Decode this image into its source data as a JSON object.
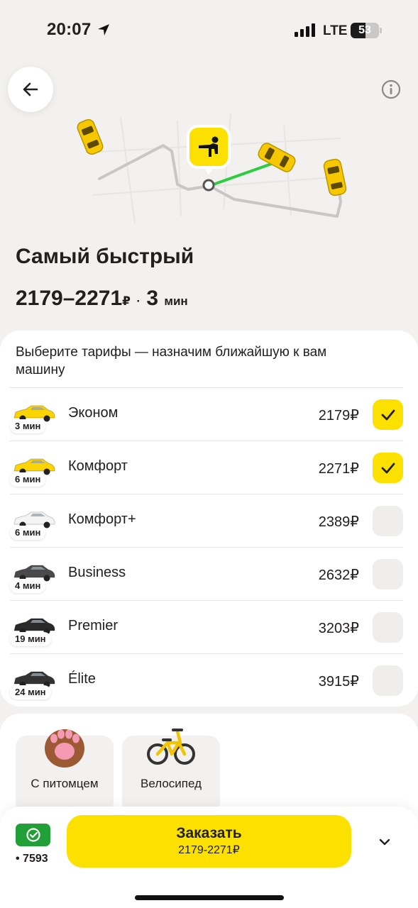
{
  "status_bar": {
    "time": "20:07",
    "network": "LTE",
    "battery_level": "53",
    "battery_fraction": 0.53
  },
  "colors": {
    "accent": "#fce000",
    "check_on": "#fce000",
    "check_off": "#efeeec",
    "route_active": "#2ecc40",
    "payment": "#21a038"
  },
  "header": {
    "back_icon": "arrow-left-icon",
    "info_icon": "info-icon"
  },
  "summary": {
    "title": "Самый быстрый",
    "price_range": "2179–2271",
    "currency": "₽",
    "separator": "·",
    "eta_value": "3",
    "eta_unit": "мин"
  },
  "tariffs": {
    "hint": "Выберите тарифы — назначим ближайшую к вам машину",
    "items": [
      {
        "name": "Эконом",
        "eta": "3 мин",
        "price": "2179₽",
        "selected": true,
        "car_color": "#fcd400"
      },
      {
        "name": "Комфорт",
        "eta": "6 мин",
        "price": "2271₽",
        "selected": true,
        "car_color": "#fcd400"
      },
      {
        "name": "Комфорт+",
        "eta": "6 мин",
        "price": "2389₽",
        "selected": false,
        "car_color": "#f4f4f4"
      },
      {
        "name": "Business",
        "eta": "4 мин",
        "price": "2632₽",
        "selected": false,
        "car_color": "#4a4a4a"
      },
      {
        "name": "Premier",
        "eta": "19 мин",
        "price": "3203₽",
        "selected": false,
        "car_color": "#2a2a2a"
      },
      {
        "name": "Élite",
        "eta": "24 мин",
        "price": "3915₽",
        "selected": false,
        "car_color": "#333333"
      }
    ]
  },
  "options": {
    "pet": {
      "label": "С питомцем",
      "icon": "paw-icon"
    },
    "bike": {
      "label": "Велосипед",
      "icon": "bicycle-icon"
    }
  },
  "bottom": {
    "payment_card": "• 7593",
    "payment_icon": "payment-check-icon",
    "order_label": "Заказать",
    "order_price": "2179-2271₽",
    "expand_icon": "chevron-down-icon"
  }
}
